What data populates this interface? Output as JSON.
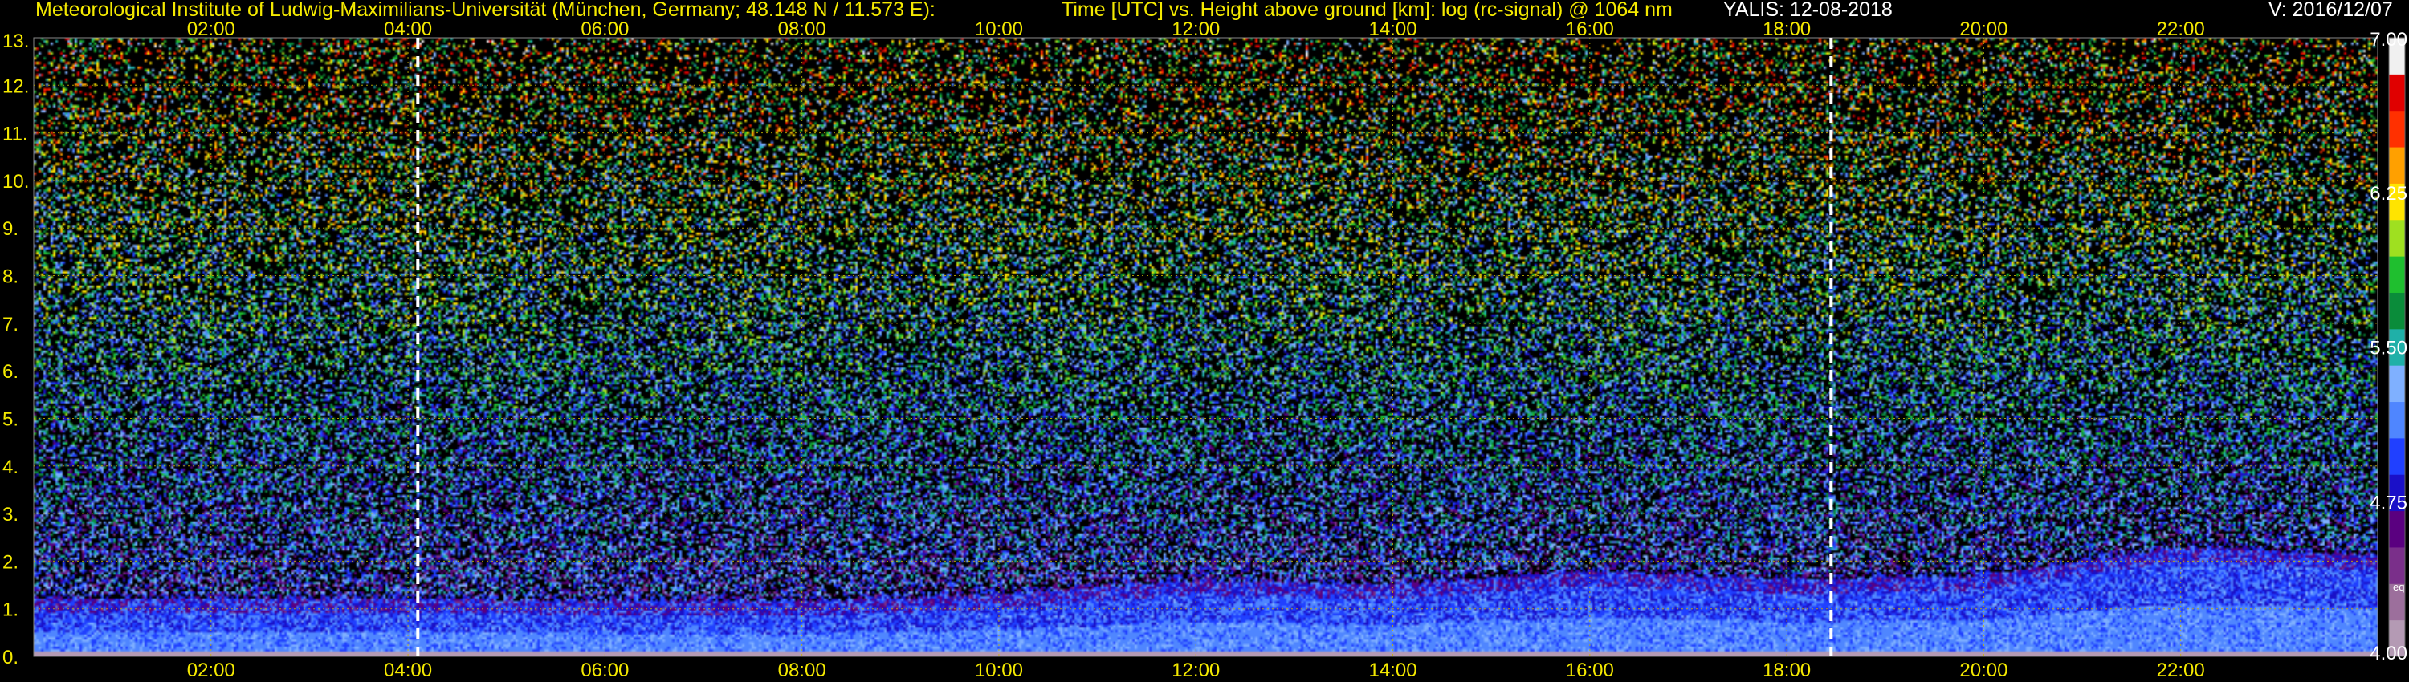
{
  "header": {
    "institute": "Meteorological Institute of Ludwig-Maximilians-Universität (München, Germany; 48.148 N / 11.573 E):",
    "description": "Time [UTC] vs. Height above ground [km]: log (rc-signal) @ 1064 nm",
    "instrument_date": "YALIS: 12-08-2018",
    "version": "V: 2016/12/07"
  },
  "colorbar": {
    "min": 4.0,
    "max": 7.0,
    "tick_labels": [
      "7.00",
      "6.25",
      "5.50",
      "4.75",
      "4.00"
    ],
    "tick_values": [
      7.0,
      6.25,
      5.5,
      4.75,
      4.0
    ],
    "small_label": "eq",
    "colors": [
      "#b49ab4",
      "#9c6f9c",
      "#7a2f8a",
      "#5a0080",
      "#1a10c8",
      "#2040ff",
      "#4f86ff",
      "#7fb0ff",
      "#1fb0a8",
      "#0a8c3a",
      "#1fbf2f",
      "#9fe020",
      "#ffe400",
      "#ffa000",
      "#ff3000",
      "#e00000",
      "#f0f0f0"
    ]
  },
  "chart_data": {
    "type": "heatmap",
    "title": "Time [UTC] vs. Height above ground [km]: log (rc-signal) @ 1064 nm",
    "x_range_hours_utc": [
      0.2,
      24.0
    ],
    "y_range_km": [
      0,
      13
    ],
    "x_tick_labels": [
      "02:00",
      "04:00",
      "06:00",
      "08:00",
      "10:00",
      "12:00",
      "14:00",
      "16:00",
      "18:00",
      "20:00",
      "22:00"
    ],
    "x_tick_hours": [
      2,
      4,
      6,
      8,
      10,
      12,
      14,
      16,
      18,
      20,
      22
    ],
    "y_tick_labels": [
      "0.",
      "1.",
      "2.",
      "3.",
      "4.",
      "5.",
      "6.",
      "7.",
      "8.",
      "9.",
      "10.",
      "11.",
      "12.",
      "13."
    ],
    "y_tick_km": [
      0,
      1,
      2,
      3,
      4,
      5,
      6,
      7,
      8,
      9,
      10,
      11,
      12,
      13
    ],
    "marker_lines_hours": [
      4.1,
      18.45
    ],
    "grid": true,
    "value_range": [
      4.0,
      7.0
    ],
    "boundary_layer_top_km": [
      {
        "hour": 0.2,
        "km": 0.9
      },
      {
        "hour": 4.0,
        "km": 0.9
      },
      {
        "hour": 8.0,
        "km": 0.85
      },
      {
        "hour": 10.0,
        "km": 1.0
      },
      {
        "hour": 12.0,
        "km": 1.3
      },
      {
        "hour": 14.0,
        "km": 1.2
      },
      {
        "hour": 16.0,
        "km": 1.5
      },
      {
        "hour": 18.0,
        "km": 1.3
      },
      {
        "hour": 20.0,
        "km": 1.4
      },
      {
        "hour": 22.0,
        "km": 2.0
      },
      {
        "hour": 24.0,
        "km": 1.8
      }
    ]
  }
}
